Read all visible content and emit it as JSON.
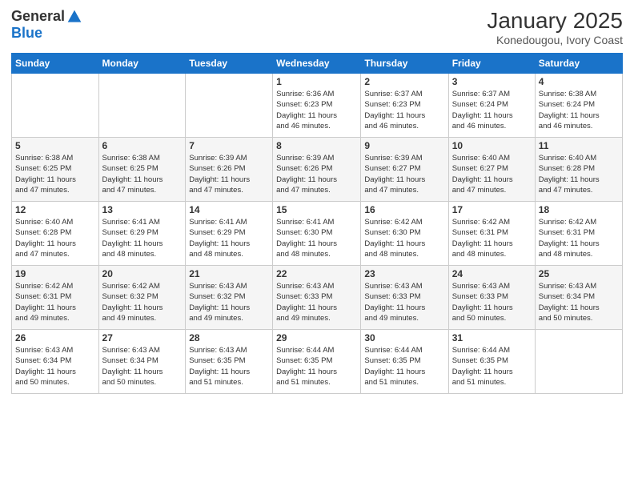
{
  "logo": {
    "general": "General",
    "blue": "Blue"
  },
  "title": "January 2025",
  "subtitle": "Konedougou, Ivory Coast",
  "headers": [
    "Sunday",
    "Monday",
    "Tuesday",
    "Wednesday",
    "Thursday",
    "Friday",
    "Saturday"
  ],
  "weeks": [
    [
      {
        "day": "",
        "info": ""
      },
      {
        "day": "",
        "info": ""
      },
      {
        "day": "",
        "info": ""
      },
      {
        "day": "1",
        "info": "Sunrise: 6:36 AM\nSunset: 6:23 PM\nDaylight: 11 hours\nand 46 minutes."
      },
      {
        "day": "2",
        "info": "Sunrise: 6:37 AM\nSunset: 6:23 PM\nDaylight: 11 hours\nand 46 minutes."
      },
      {
        "day": "3",
        "info": "Sunrise: 6:37 AM\nSunset: 6:24 PM\nDaylight: 11 hours\nand 46 minutes."
      },
      {
        "day": "4",
        "info": "Sunrise: 6:38 AM\nSunset: 6:24 PM\nDaylight: 11 hours\nand 46 minutes."
      }
    ],
    [
      {
        "day": "5",
        "info": "Sunrise: 6:38 AM\nSunset: 6:25 PM\nDaylight: 11 hours\nand 47 minutes."
      },
      {
        "day": "6",
        "info": "Sunrise: 6:38 AM\nSunset: 6:25 PM\nDaylight: 11 hours\nand 47 minutes."
      },
      {
        "day": "7",
        "info": "Sunrise: 6:39 AM\nSunset: 6:26 PM\nDaylight: 11 hours\nand 47 minutes."
      },
      {
        "day": "8",
        "info": "Sunrise: 6:39 AM\nSunset: 6:26 PM\nDaylight: 11 hours\nand 47 minutes."
      },
      {
        "day": "9",
        "info": "Sunrise: 6:39 AM\nSunset: 6:27 PM\nDaylight: 11 hours\nand 47 minutes."
      },
      {
        "day": "10",
        "info": "Sunrise: 6:40 AM\nSunset: 6:27 PM\nDaylight: 11 hours\nand 47 minutes."
      },
      {
        "day": "11",
        "info": "Sunrise: 6:40 AM\nSunset: 6:28 PM\nDaylight: 11 hours\nand 47 minutes."
      }
    ],
    [
      {
        "day": "12",
        "info": "Sunrise: 6:40 AM\nSunset: 6:28 PM\nDaylight: 11 hours\nand 47 minutes."
      },
      {
        "day": "13",
        "info": "Sunrise: 6:41 AM\nSunset: 6:29 PM\nDaylight: 11 hours\nand 48 minutes."
      },
      {
        "day": "14",
        "info": "Sunrise: 6:41 AM\nSunset: 6:29 PM\nDaylight: 11 hours\nand 48 minutes."
      },
      {
        "day": "15",
        "info": "Sunrise: 6:41 AM\nSunset: 6:30 PM\nDaylight: 11 hours\nand 48 minutes."
      },
      {
        "day": "16",
        "info": "Sunrise: 6:42 AM\nSunset: 6:30 PM\nDaylight: 11 hours\nand 48 minutes."
      },
      {
        "day": "17",
        "info": "Sunrise: 6:42 AM\nSunset: 6:31 PM\nDaylight: 11 hours\nand 48 minutes."
      },
      {
        "day": "18",
        "info": "Sunrise: 6:42 AM\nSunset: 6:31 PM\nDaylight: 11 hours\nand 48 minutes."
      }
    ],
    [
      {
        "day": "19",
        "info": "Sunrise: 6:42 AM\nSunset: 6:31 PM\nDaylight: 11 hours\nand 49 minutes."
      },
      {
        "day": "20",
        "info": "Sunrise: 6:42 AM\nSunset: 6:32 PM\nDaylight: 11 hours\nand 49 minutes."
      },
      {
        "day": "21",
        "info": "Sunrise: 6:43 AM\nSunset: 6:32 PM\nDaylight: 11 hours\nand 49 minutes."
      },
      {
        "day": "22",
        "info": "Sunrise: 6:43 AM\nSunset: 6:33 PM\nDaylight: 11 hours\nand 49 minutes."
      },
      {
        "day": "23",
        "info": "Sunrise: 6:43 AM\nSunset: 6:33 PM\nDaylight: 11 hours\nand 49 minutes."
      },
      {
        "day": "24",
        "info": "Sunrise: 6:43 AM\nSunset: 6:33 PM\nDaylight: 11 hours\nand 50 minutes."
      },
      {
        "day": "25",
        "info": "Sunrise: 6:43 AM\nSunset: 6:34 PM\nDaylight: 11 hours\nand 50 minutes."
      }
    ],
    [
      {
        "day": "26",
        "info": "Sunrise: 6:43 AM\nSunset: 6:34 PM\nDaylight: 11 hours\nand 50 minutes."
      },
      {
        "day": "27",
        "info": "Sunrise: 6:43 AM\nSunset: 6:34 PM\nDaylight: 11 hours\nand 50 minutes."
      },
      {
        "day": "28",
        "info": "Sunrise: 6:43 AM\nSunset: 6:35 PM\nDaylight: 11 hours\nand 51 minutes."
      },
      {
        "day": "29",
        "info": "Sunrise: 6:44 AM\nSunset: 6:35 PM\nDaylight: 11 hours\nand 51 minutes."
      },
      {
        "day": "30",
        "info": "Sunrise: 6:44 AM\nSunset: 6:35 PM\nDaylight: 11 hours\nand 51 minutes."
      },
      {
        "day": "31",
        "info": "Sunrise: 6:44 AM\nSunset: 6:35 PM\nDaylight: 11 hours\nand 51 minutes."
      },
      {
        "day": "",
        "info": ""
      }
    ]
  ]
}
